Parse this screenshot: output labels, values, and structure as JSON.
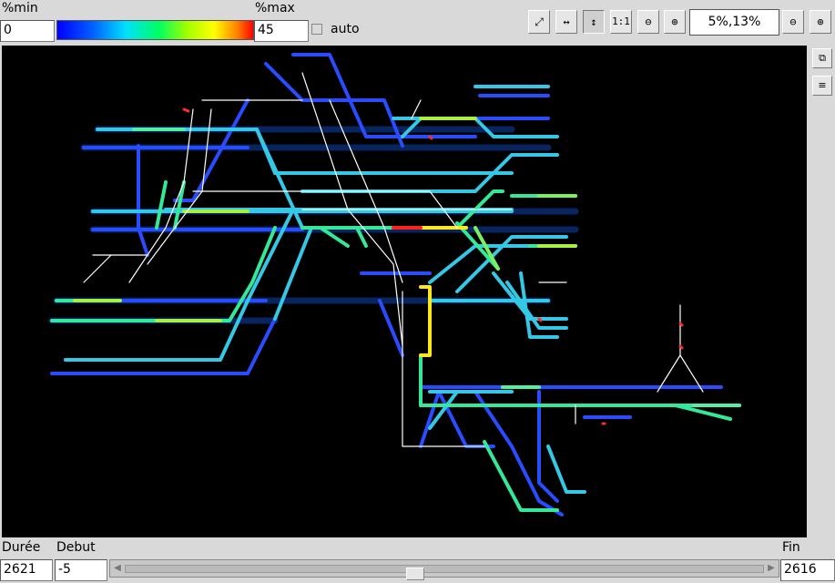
{
  "header": {
    "min_label": "%min",
    "min_value": "0",
    "max_label": "%max",
    "max_value": "45",
    "auto_label": "auto",
    "zoom_value": "5%,13%"
  },
  "toolbar": {
    "buttons": [
      {
        "name": "fit-all-icon",
        "glyph": "⤢"
      },
      {
        "name": "fit-width-icon",
        "glyph": "↔"
      },
      {
        "name": "fit-height-icon",
        "glyph": "↕"
      },
      {
        "name": "zoom-one-to-one-icon",
        "glyph": "1:1"
      },
      {
        "name": "zoom-out-icon",
        "glyph": "⊖"
      },
      {
        "name": "zoom-in-icon",
        "glyph": "⊕"
      }
    ],
    "after": [
      {
        "name": "zoom-out-y-icon",
        "glyph": "⊖"
      },
      {
        "name": "zoom-in-y-icon",
        "glyph": "⊕"
      }
    ]
  },
  "side": [
    {
      "name": "window-icon",
      "glyph": "⧉"
    },
    {
      "name": "layers-icon",
      "glyph": "≡"
    }
  ],
  "footer": {
    "duration_label": "Durée",
    "duration_value": "2621",
    "debut_label": "Debut",
    "debut_value": "-5",
    "fin_label": "Fin",
    "fin_value": "2616",
    "scroll_left": "◀",
    "scroll_right": "▶"
  },
  "colors": {
    "scale_min": "#0000ff",
    "scale_max": "#ff0000"
  }
}
